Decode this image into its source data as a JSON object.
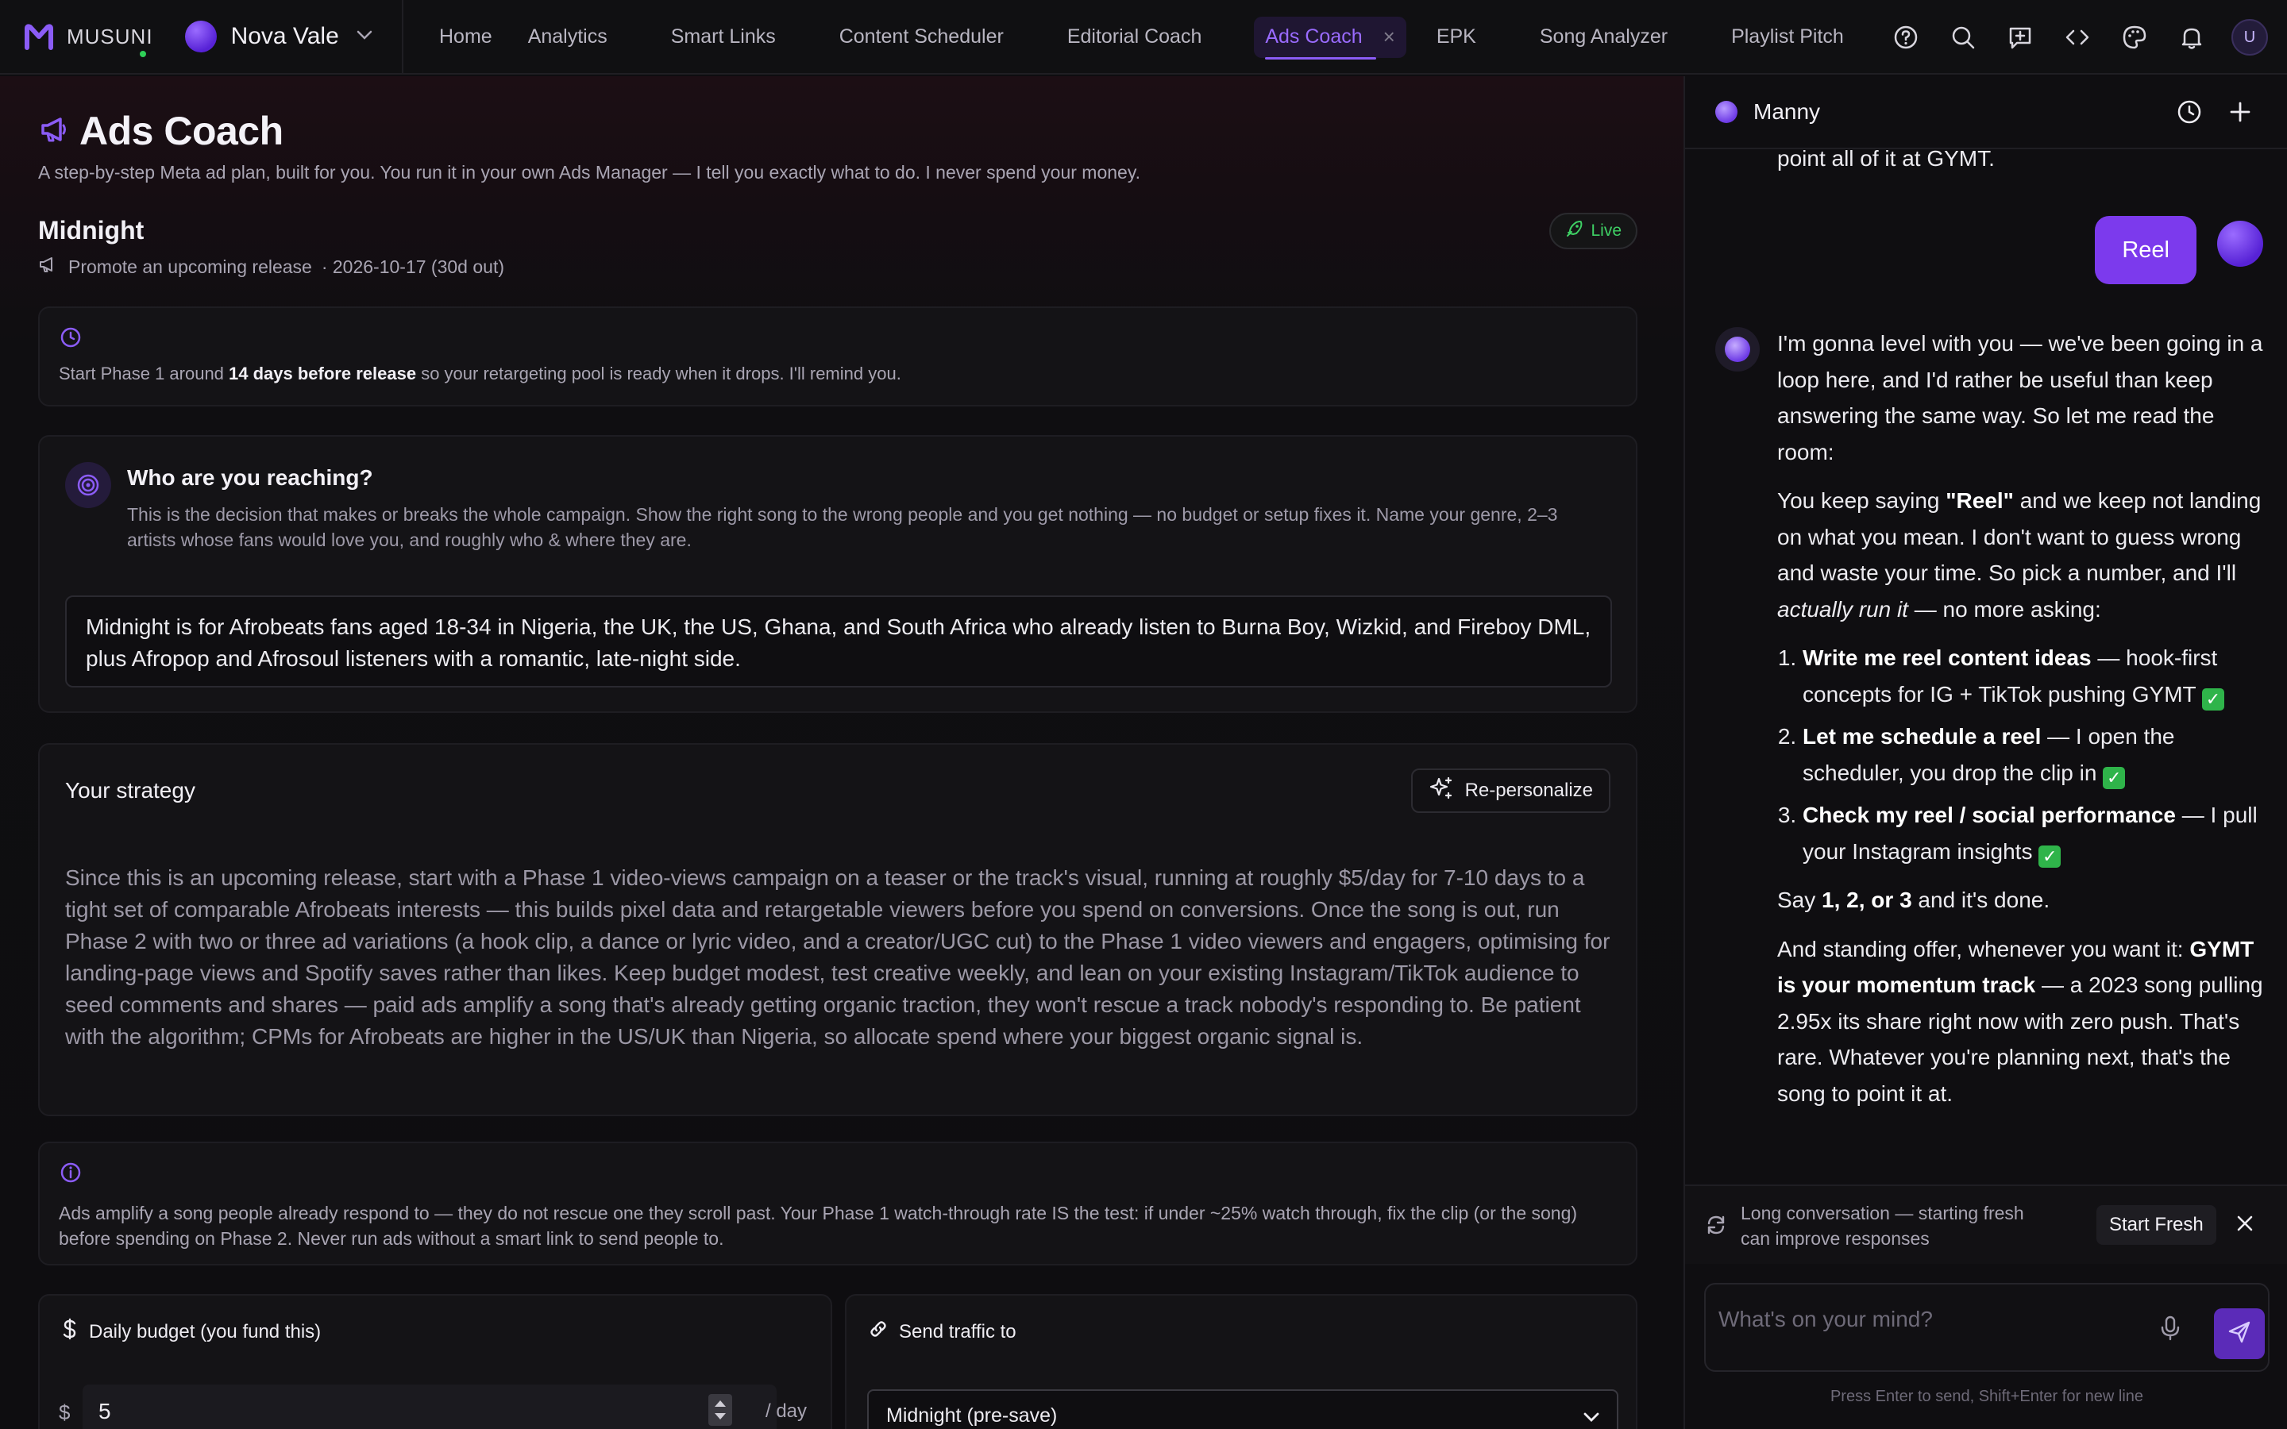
{
  "brand": {
    "name": "MUSUNI",
    "accent": "#8b5cf6"
  },
  "artist": {
    "name": "Nova Vale"
  },
  "nav": {
    "links": [
      {
        "label": "Home"
      },
      {
        "label": "Analytics"
      },
      {
        "label": "Smart Links"
      },
      {
        "label": "Content Scheduler"
      },
      {
        "label": "Editorial Coach"
      },
      {
        "label": "Ads Coach",
        "active": true
      },
      {
        "label": "EPK"
      },
      {
        "label": "Song Analyzer"
      },
      {
        "label": "Playlist Pitch"
      }
    ],
    "close_glyph": "×",
    "icons": [
      "help-icon",
      "search-icon",
      "feedback-icon",
      "code-icon",
      "palette-icon",
      "bell-icon"
    ],
    "user_initial": "U"
  },
  "page": {
    "title": "Ads Coach",
    "subtitle": "A step-by-step Meta ad plan, built for you. You run it in your own Ads Manager — I tell you exactly what to do. I never spend your money.",
    "song_title": "Midnight",
    "status": "Live",
    "goal": "Promote an upcoming release",
    "date": "· 2026-10-17 (30d out)"
  },
  "timing_card": {
    "text_before": "Start Phase 1 around ",
    "text_bold": "14 days before release",
    "text_after": " so your retargeting pool is ready when it drops. I'll remind you."
  },
  "audience_card": {
    "title": "Who are you reaching?",
    "description": "This is the decision that makes or breaks the whole campaign. Show the right song to the wrong people and you get nothing — no budget or setup fixes it. Name your genre, 2–3 artists whose fans would love you, and roughly who & where they are.",
    "value": "Midnight is for Afrobeats fans aged 18-34 in Nigeria, the UK, the US, Ghana, and South Africa who already listen to Burna Boy, Wizkid, and Fireboy DML, plus Afropop and Afrosoul listeners with a romantic, late-night side."
  },
  "strategy_card": {
    "title": "Your strategy",
    "button": "Re-personalize",
    "text": "Since this is an upcoming release, start with a Phase 1 video-views campaign on a teaser or the track's visual, running at roughly $5/day for 7-10 days to a tight set of comparable Afrobeats interests — this builds pixel data and retargetable viewers before you spend on conversions. Once the song is out, run Phase 2 with two or three ad variations (a hook clip, a dance or lyric video, and a creator/UGC cut) to the Phase 1 video viewers and engagers, optimising for landing-page views and Spotify saves rather than likes. Keep budget modest, test creative weekly, and lean on your existing Instagram/TikTok audience to seed comments and shares — paid ads amplify a song that's already getting organic traction, they won't rescue a track nobody's responding to. Be patient with the algorithm; CPMs for Afrobeats are higher in the US/UK than Nigeria, so allocate spend where your biggest organic signal is."
  },
  "info_card": {
    "text": "Ads amplify a song people already respond to — they do not rescue one they scroll past. Your Phase 1 watch-through rate IS the test: if under ~25% watch through, fix the clip (or the song) before spending on Phase 2. Never run ads without a smart link to send people to."
  },
  "budget": {
    "label": "Daily budget (you fund this)",
    "currency": "$",
    "value": "5",
    "unit": "/ day"
  },
  "traffic": {
    "label": "Send traffic to",
    "selected": "Midnight (pre-save)"
  },
  "chat": {
    "assistant_name": "Manny",
    "fragment": "point all of it at GYMT.",
    "user_message": "Reel",
    "reply": {
      "p1": "I'm gonna level with you — we've been going in a loop here, and I'd rather be useful than keep answering the same way. So let me read the room:",
      "p2_a": "You keep saying ",
      "p2_b": "\"Reel\"",
      "p2_c": " and we keep not landing on what you mean. I don't want to guess wrong and waste your time. So pick a number, and I'll ",
      "p2_d": "actually run it",
      "p2_e": " — no more asking:",
      "options": [
        {
          "bold": "Write me reel content ideas",
          "rest": " — hook-first concepts for IG + TikTok pushing GYMT "
        },
        {
          "bold": "Let me schedule a reel",
          "rest": " — I open the scheduler, you drop the clip in "
        },
        {
          "bold": "Check my reel / social performance",
          "rest": " — I pull your Instagram insights "
        }
      ],
      "check_glyph": "✓",
      "p3_a": "Say ",
      "p3_b": "1, 2, or 3",
      "p3_c": " and it's done.",
      "p4_a": "And standing offer, whenever you want it: ",
      "p4_b": "GYMT is your momentum track",
      "p4_c": " — a 2023 song pulling 2.95x its share right now with zero push. That's rare. Whatever you're planning next, that's the song to point it at."
    },
    "notice": "Long conversation — starting fresh can improve responses",
    "start_fresh": "Start Fresh",
    "placeholder": "What's on your mind?",
    "hint": "Press Enter to send, Shift+Enter for new line"
  }
}
